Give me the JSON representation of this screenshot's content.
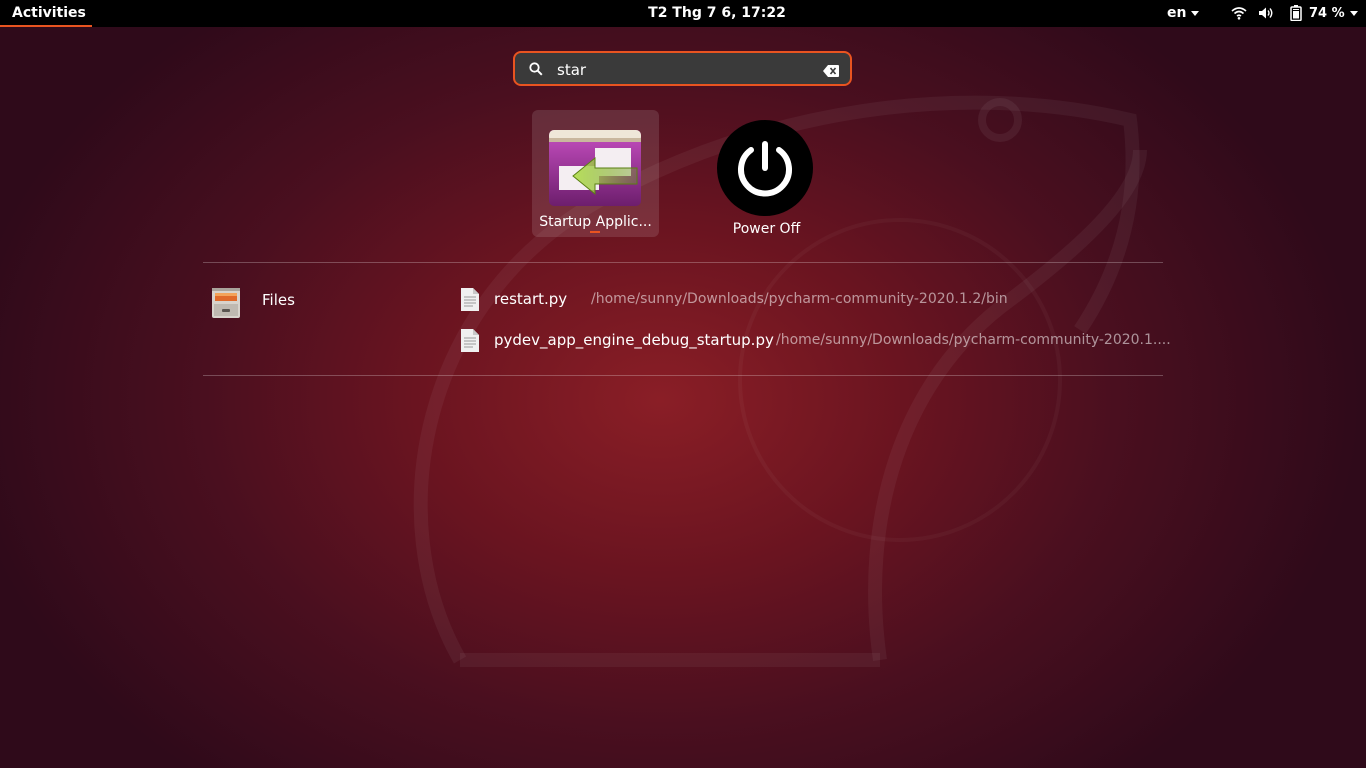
{
  "topbar": {
    "activities_label": "Activities",
    "clock": "T2 Thg 7  6, 17:22",
    "language": "en",
    "battery_percent": "74 %",
    "icons": [
      "wifi-icon",
      "volume-icon",
      "battery-icon"
    ]
  },
  "search": {
    "value": "star",
    "icon": "search-icon",
    "clear_icon": "clear-icon"
  },
  "apps": [
    {
      "label": "Startup Applic...",
      "icon": "startup-applications-icon",
      "selected": true,
      "running": true
    },
    {
      "label": "Power Off",
      "icon": "power-icon",
      "selected": false
    }
  ],
  "files_provider": {
    "name": "Files",
    "icon": "file-cabinet-icon",
    "results": [
      {
        "name": "restart.py",
        "path": "/home/sunny/Downloads/pycharm-community-2020.1.2/bin"
      },
      {
        "name": "pydev_app_engine_debug_startup.py",
        "path": "/home/sunny/Downloads/pycharm-community-2020.1...."
      }
    ]
  },
  "colors": {
    "accent": "#e95420",
    "topbar": "#000000",
    "search_bg": "#3a3a3a"
  }
}
